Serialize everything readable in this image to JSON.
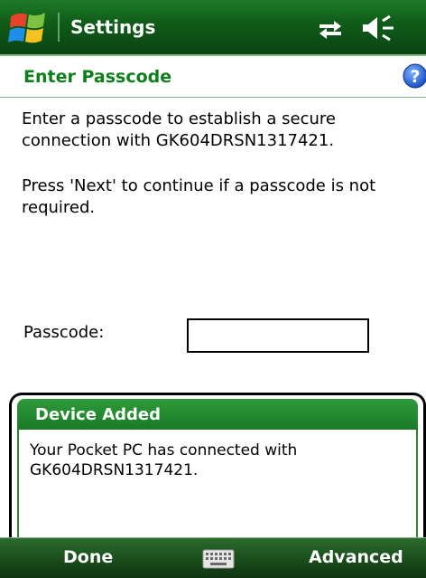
{
  "titlebar": {
    "title": "Settings"
  },
  "section": {
    "title": "Enter Passcode"
  },
  "body": {
    "paragraph1": "Enter a passcode to establish a secure connection with GK604DRSN1317421.",
    "paragraph2": "Press 'Next' to continue if a passcode is not required."
  },
  "passcode": {
    "label": "Passcode:",
    "value": ""
  },
  "notification": {
    "title": "Device Added",
    "message": "Your Pocket PC has connected with GK604DRSN1317421."
  },
  "softkeys": {
    "left": "Done",
    "right": "Advanced"
  },
  "colors": {
    "accent_green": "#0e7d1c",
    "titlebar_green": "#1f7a2a"
  },
  "icons": {
    "start": "windows-logo-icon",
    "connectivity": "data-connection-icon",
    "volume": "speaker-icon",
    "help": "help-icon",
    "keyboard": "keyboard-icon"
  }
}
